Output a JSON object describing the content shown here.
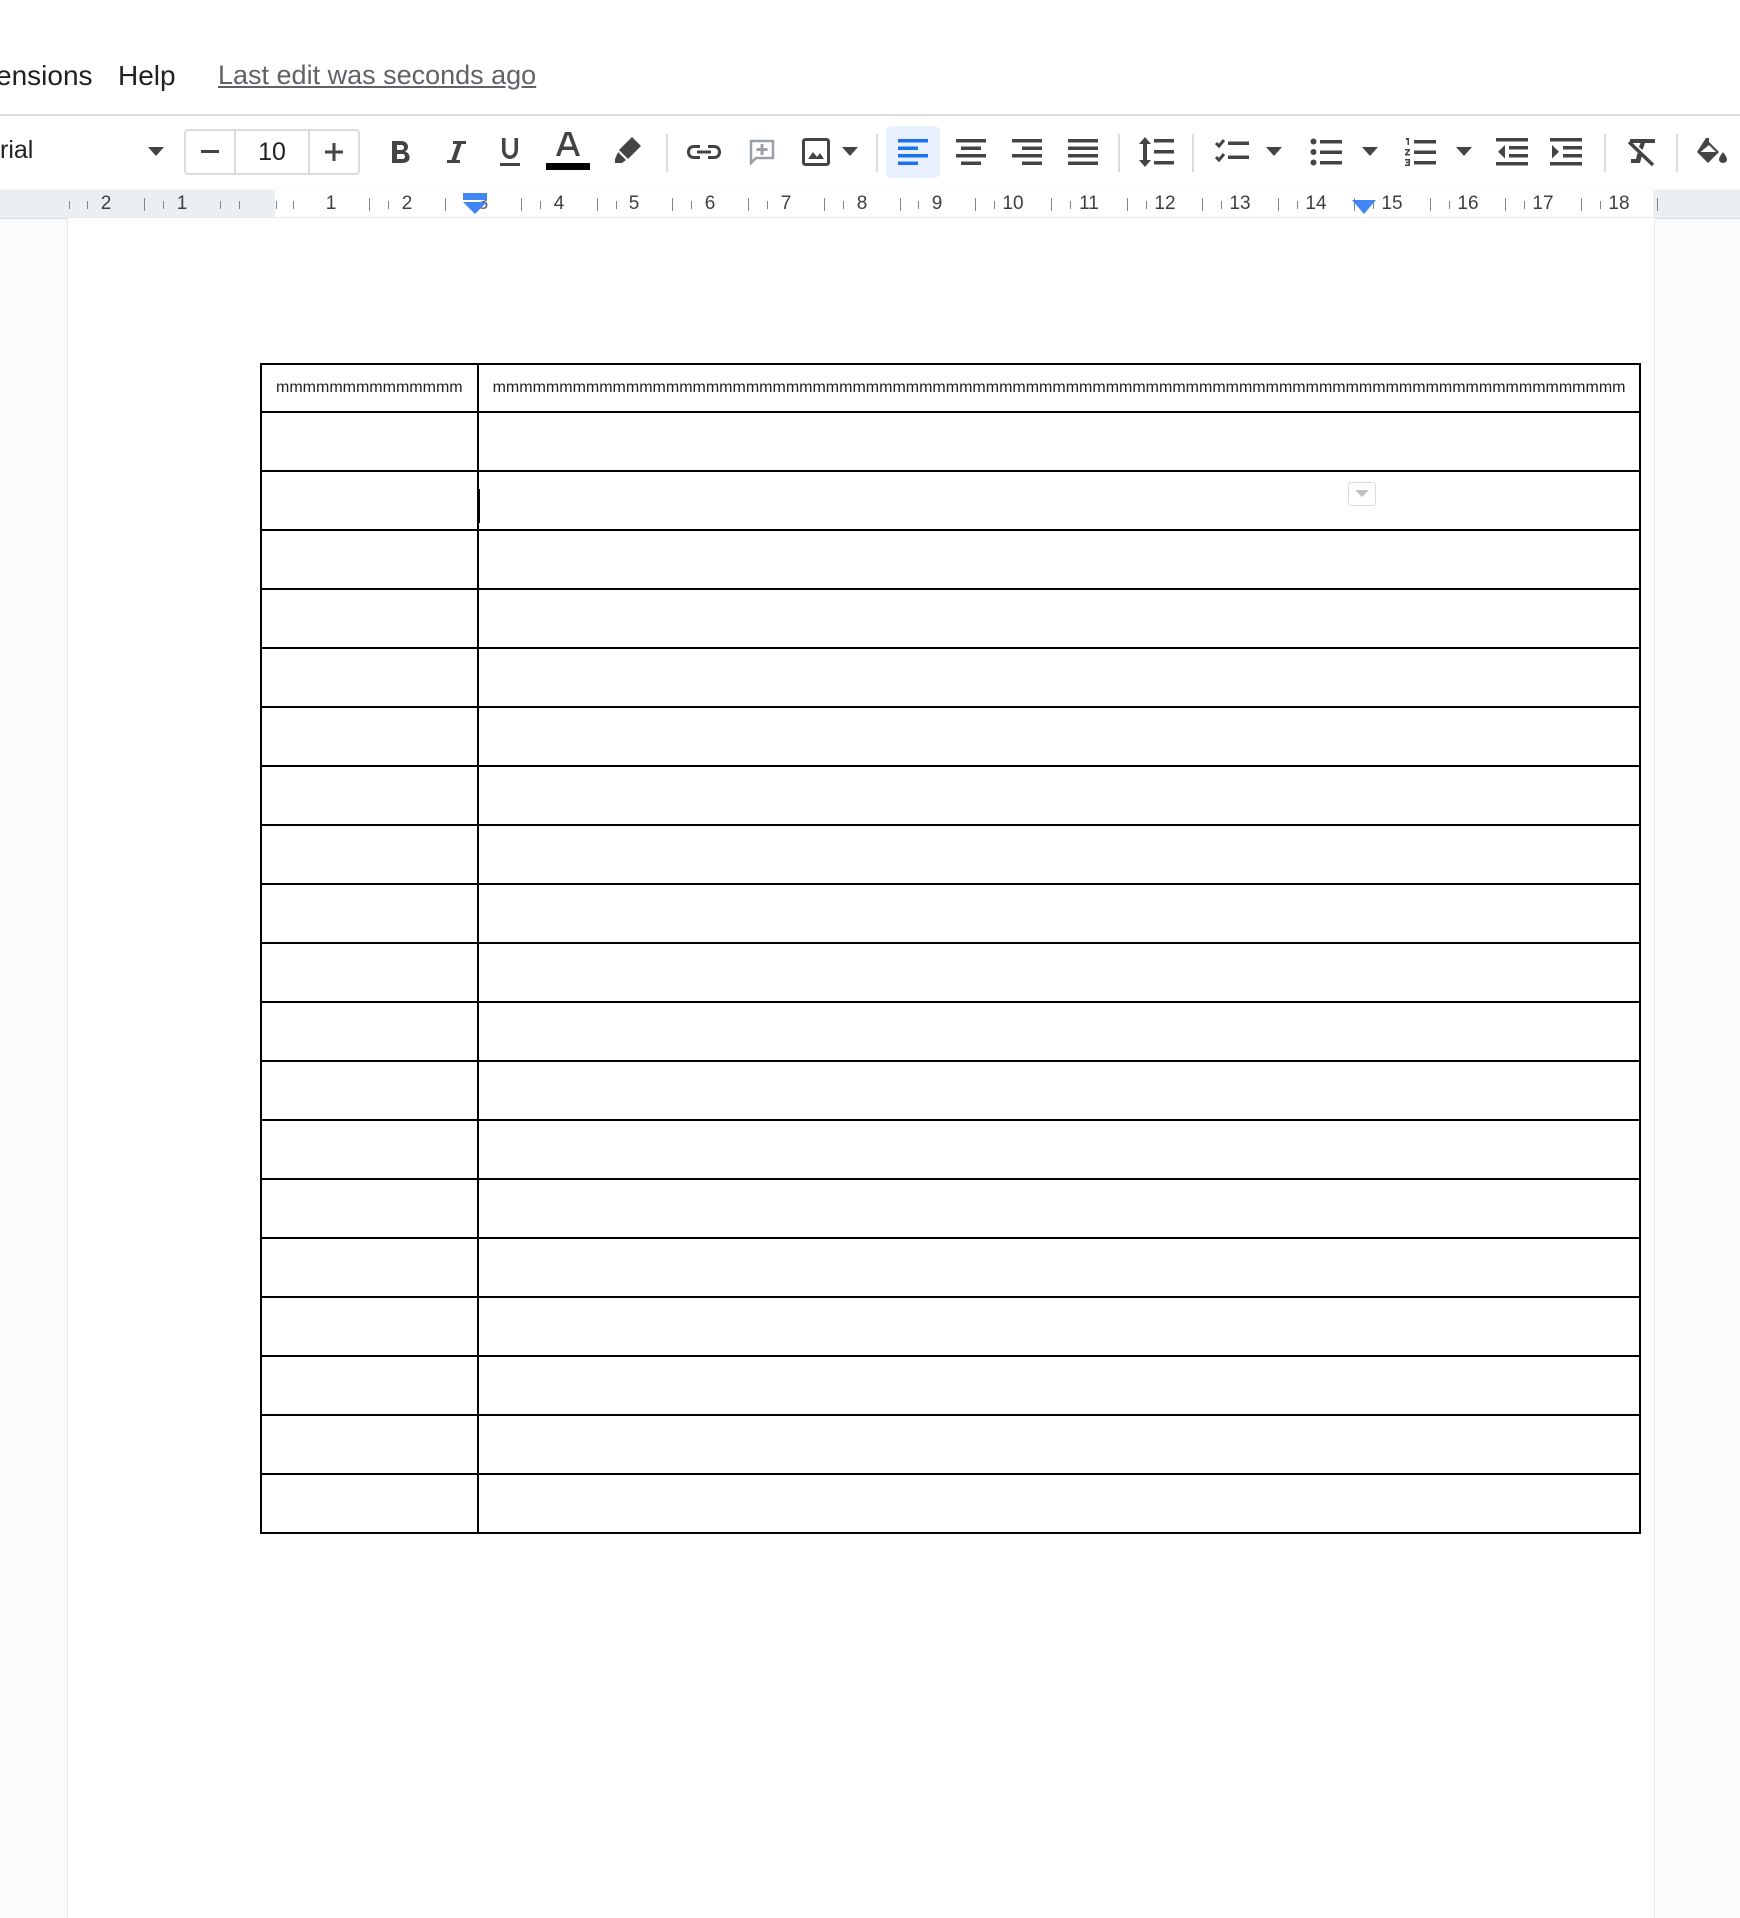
{
  "menubar": {
    "items": [
      {
        "label": "ensions"
      },
      {
        "label": "Help"
      }
    ],
    "last_edit": "Last edit was seconds ago"
  },
  "toolbar": {
    "font_name": "rial",
    "font_size": "10",
    "icons": [
      "chevron-down-icon",
      "minus-icon",
      "plus-icon",
      "bold-icon",
      "italic-icon",
      "underline-icon",
      "text-color-icon",
      "highlight-icon",
      "link-icon",
      "add-comment-icon",
      "insert-image-icon",
      "align-left-icon",
      "align-center-icon",
      "align-right-icon",
      "align-justify-icon",
      "line-spacing-icon",
      "checklist-icon",
      "bulleted-list-icon",
      "numbered-list-icon",
      "decrease-indent-icon",
      "increase-indent-icon",
      "clear-formatting-icon",
      "paint-bucket-icon"
    ],
    "text_color": "#000000",
    "active_color": "#1a73e8"
  },
  "ruler": {
    "labels": [
      "2",
      "1",
      "1",
      "2",
      "3",
      "4",
      "5",
      "6",
      "7",
      "8",
      "9",
      "10",
      "11",
      "12",
      "13",
      "14",
      "15",
      "16",
      "17",
      "18"
    ],
    "marker_color": "#4285f4"
  },
  "table": {
    "header": [
      "mmmmmmmmmmmmmm",
      "mmmmmmmmmmmmmmmmmmmmmmmmmmmmmmmmmmmmmmmmmmmmmmmmmmmmmmmmmmmmmmmmmmmmmmmmmmmmmmmmmmmmm"
    ],
    "rows": [
      [
        "",
        ""
      ],
      [
        "",
        ""
      ],
      [
        "",
        ""
      ],
      [
        "",
        ""
      ],
      [
        "",
        ""
      ],
      [
        "",
        ""
      ],
      [
        "",
        ""
      ],
      [
        "",
        ""
      ],
      [
        "",
        ""
      ],
      [
        "",
        ""
      ],
      [
        "",
        ""
      ],
      [
        "",
        ""
      ],
      [
        "",
        ""
      ],
      [
        "",
        ""
      ],
      [
        "",
        ""
      ],
      [
        "",
        ""
      ],
      [
        "",
        ""
      ],
      [
        "",
        ""
      ],
      [
        "",
        ""
      ]
    ]
  }
}
